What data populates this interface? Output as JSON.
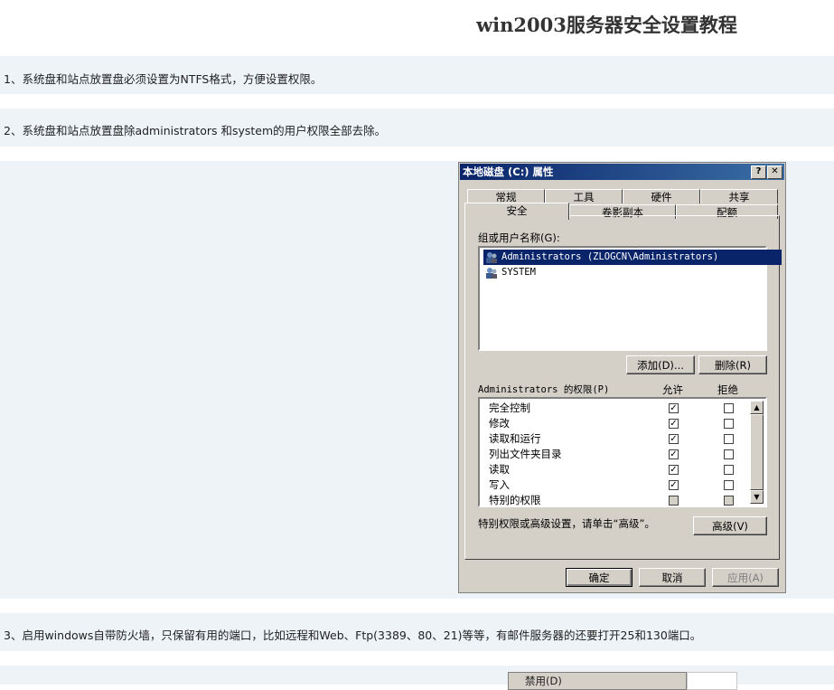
{
  "article": {
    "title": "win2003服务器安全设置教程",
    "steps": [
      "1、系统盘和站点放置盘必须设置为NTFS格式，方便设置权限。",
      "2、系统盘和站点放置盘除administrators 和system的用户权限全部去除。",
      "3、启用windows自带防火墙，只保留有用的端口，比如远程和Web、Ftp(3389、80、21)等等，有邮件服务器的还要打开25和130端口。"
    ]
  },
  "dialog": {
    "title": "本地磁盘 (C:) 属性",
    "help_btn": "?",
    "close_btn": "✕",
    "tabs_row1": [
      "常规",
      "工具",
      "硬件",
      "共享"
    ],
    "tabs_row2": [
      "安全",
      "卷影副本",
      "配额"
    ],
    "users_label": "组或用户名称(G):",
    "users": [
      {
        "name": "Administrators (ZLOGCN\\Administrators)",
        "selected": true
      },
      {
        "name": "SYSTEM",
        "selected": false
      }
    ],
    "add_btn": "添加(D)...",
    "remove_btn": "删除(R)",
    "perm_label": "Administrators 的权限(P)",
    "allow_col": "允许",
    "deny_col": "拒绝",
    "permissions": [
      {
        "name": "完全控制",
        "allow": true,
        "deny": false
      },
      {
        "name": "修改",
        "allow": true,
        "deny": false
      },
      {
        "name": "读取和运行",
        "allow": true,
        "deny": false
      },
      {
        "name": "列出文件夹目录",
        "allow": true,
        "deny": false
      },
      {
        "name": "读取",
        "allow": true,
        "deny": false
      },
      {
        "name": "写入",
        "allow": true,
        "deny": false
      },
      {
        "name": "特别的权限",
        "allow": false,
        "deny": false,
        "disabled": true
      }
    ],
    "advanced_text": "特别权限或高级设置，请单击“高级”。",
    "advanced_btn": "高级(V)",
    "ok_btn": "确定",
    "cancel_btn": "取消",
    "apply_btn": "应用(A)"
  },
  "next_dialog_fragment": {
    "menu_item": "禁用(D)"
  }
}
